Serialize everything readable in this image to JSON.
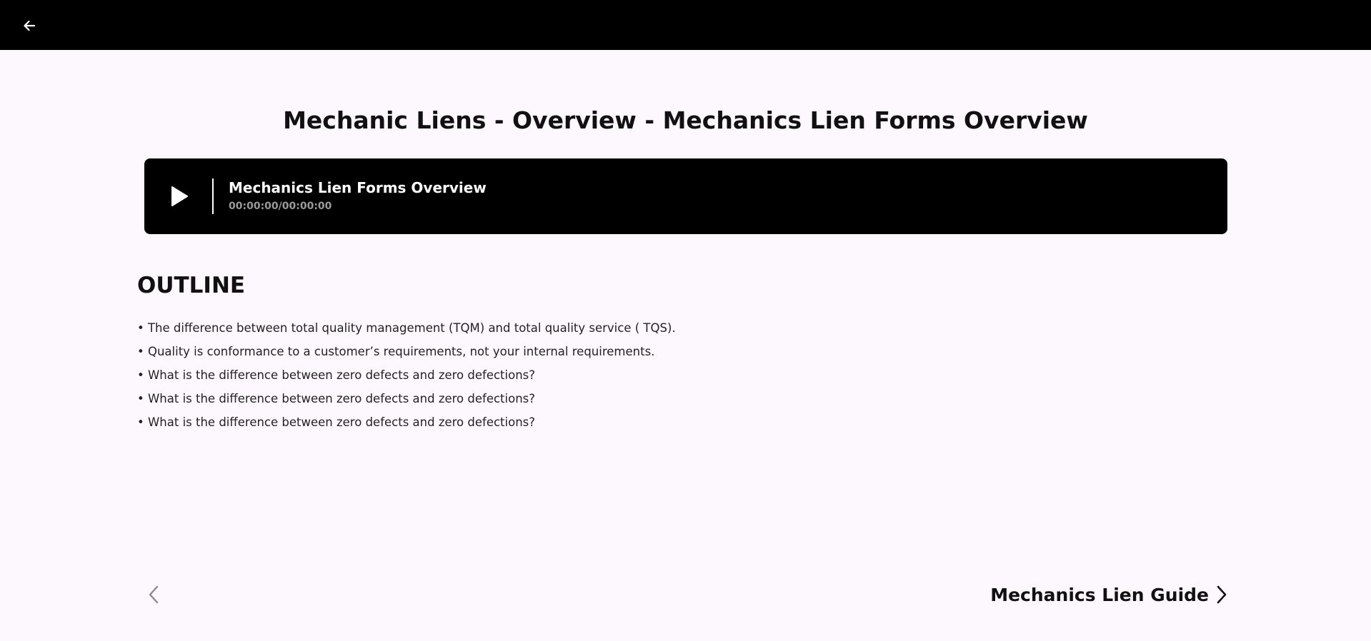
{
  "header": {
    "back_icon": "arrow-left-icon"
  },
  "page": {
    "title": "Mechanic Liens - Overview - Mechanics Lien Forms Overview"
  },
  "player": {
    "play_icon": "play-icon",
    "track_title": "Mechanics Lien Forms Overview",
    "time": "00:00:00/00:00:00"
  },
  "outline": {
    "heading": "OUTLINE",
    "items": [
      "• The difference between total quality management (TQM) and total quality service ( TQS).",
      "• Quality is conformance to a customer’s requirements, not your internal requirements.",
      "• What is the difference between zero defects and zero defections?",
      "• What is the difference between zero defects and zero defections?",
      "• What is the difference between zero defects and zero defections?"
    ]
  },
  "navigation": {
    "prev_icon": "chevron-left-icon",
    "next_label": "Mechanics Lien Guide",
    "next_icon": "chevron-right-icon"
  },
  "colors": {
    "background": "#fdf8fd",
    "topbar": "#000000",
    "player_bg": "#000000",
    "time_text": "#9a9a9a",
    "prev_disabled": "#8a8a8a"
  }
}
